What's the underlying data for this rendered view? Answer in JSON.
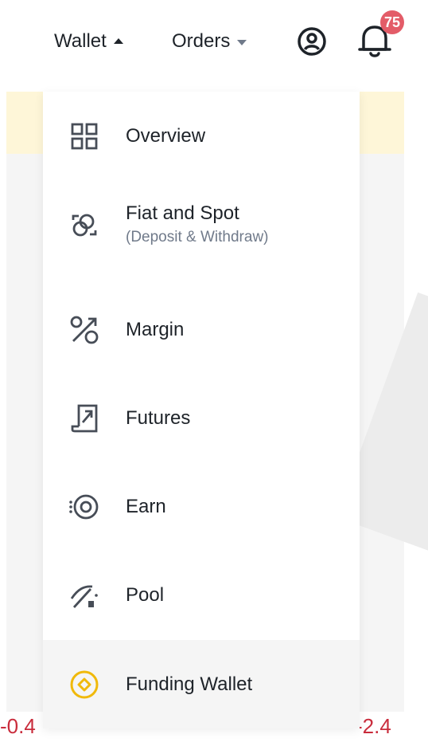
{
  "header": {
    "wallet_label": "Wallet",
    "orders_label": "Orders",
    "notification_count": "75"
  },
  "menu": {
    "items": [
      {
        "label": "Overview",
        "icon": "grid-icon"
      },
      {
        "label": "Fiat and Spot",
        "sublabel": "(Deposit & Withdraw)",
        "icon": "exchange-icon"
      },
      {
        "label": "Margin",
        "icon": "percent-icon"
      },
      {
        "label": "Futures",
        "icon": "futures-icon"
      },
      {
        "label": "Earn",
        "icon": "target-icon"
      },
      {
        "label": "Pool",
        "icon": "pickaxe-icon"
      },
      {
        "label": "Funding Wallet",
        "icon": "funding-coin-icon"
      }
    ]
  },
  "background": {
    "left_value": "-0.4",
    "right_value": "-2.4"
  },
  "colors": {
    "accent": "#f0b90b",
    "text": "#1e2329",
    "muted": "#707a8a",
    "negative": "#c92c3c",
    "badge": "#e35c68",
    "banner": "#fef6d8"
  }
}
